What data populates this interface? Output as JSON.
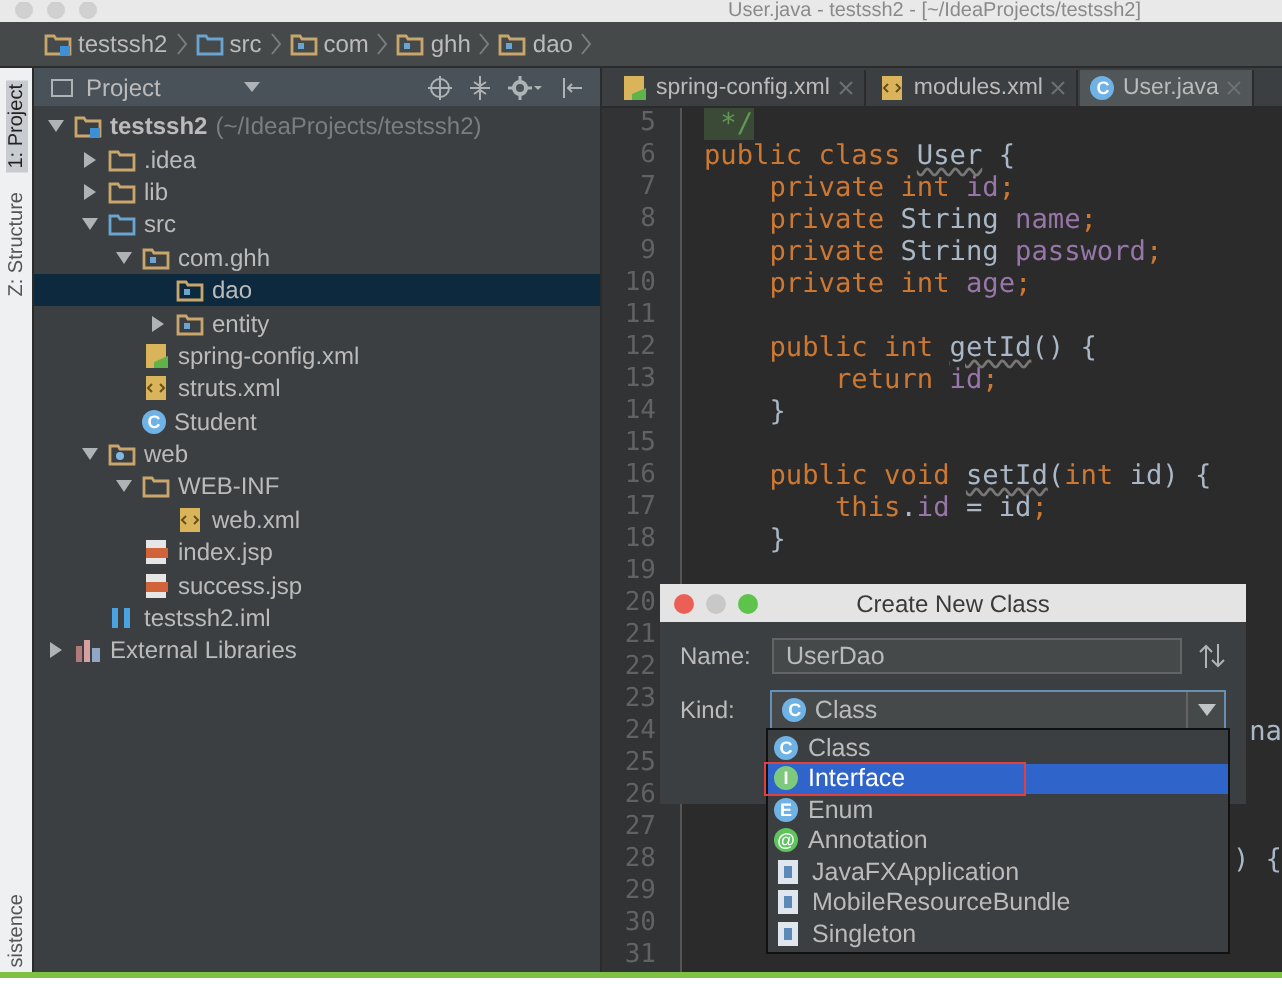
{
  "window": {
    "title": "User.java - testssh2 - [~/IdeaProjects/testssh2]"
  },
  "breadcrumbs": [
    {
      "label": "testssh2",
      "kind": "module"
    },
    {
      "label": "src",
      "kind": "source"
    },
    {
      "label": "com",
      "kind": "package"
    },
    {
      "label": "ghh",
      "kind": "package"
    },
    {
      "label": "dao",
      "kind": "package"
    }
  ],
  "tool_strip": [
    {
      "label": "1: Project",
      "selected": true
    },
    {
      "label": "Z: Structure",
      "selected": false
    },
    {
      "label": "sistence",
      "selected": false
    }
  ],
  "project_panel": {
    "title": "Project",
    "tree": [
      {
        "label": "testssh2",
        "hint": "(~/IdeaProjects/testssh2)",
        "kind": "module",
        "expanded": true,
        "selected": false,
        "children": [
          {
            "label": ".idea",
            "kind": "folder",
            "expanded": false,
            "selected": false
          },
          {
            "label": "lib",
            "kind": "folder",
            "expanded": false,
            "selected": false
          },
          {
            "label": "src",
            "kind": "source",
            "expanded": true,
            "selected": false,
            "children": [
              {
                "label": "com.ghh",
                "kind": "package",
                "expanded": true,
                "selected": false,
                "children": [
                  {
                    "label": "dao",
                    "kind": "package",
                    "selected": true
                  },
                  {
                    "label": "entity",
                    "kind": "package",
                    "expanded": false,
                    "selected": false
                  }
                ]
              },
              {
                "label": "spring-config.xml",
                "kind": "spring",
                "selected": false
              },
              {
                "label": "struts.xml",
                "kind": "xml",
                "selected": false
              },
              {
                "label": "Student",
                "kind": "class",
                "badge": "C",
                "selected": false
              }
            ]
          },
          {
            "label": "web",
            "kind": "web",
            "expanded": true,
            "selected": false,
            "children": [
              {
                "label": "WEB-INF",
                "kind": "folder",
                "expanded": true,
                "selected": false,
                "children": [
                  {
                    "label": "web.xml",
                    "kind": "xml",
                    "selected": false
                  }
                ]
              },
              {
                "label": "index.jsp",
                "kind": "jsp",
                "selected": false
              },
              {
                "label": "success.jsp",
                "kind": "jsp",
                "selected": false
              }
            ]
          },
          {
            "label": "testssh2.iml",
            "kind": "iml",
            "selected": false
          }
        ]
      },
      {
        "label": "External Libraries",
        "kind": "library",
        "expanded": false,
        "selected": false
      }
    ]
  },
  "editor": {
    "tabs": [
      {
        "label": "spring-config.xml",
        "kind": "spring",
        "selected": false
      },
      {
        "label": "modules.xml",
        "kind": "xml",
        "selected": false
      },
      {
        "label": "User.java",
        "kind": "class",
        "badge": "C",
        "selected": true
      }
    ],
    "lines": [
      {
        "number": "5",
        "tokens": [
          {
            "kind": "comment",
            "text": " */"
          }
        ]
      },
      {
        "number": "6",
        "tokens": [
          {
            "kind": "keyword",
            "text": "public class "
          },
          {
            "kind": "warn",
            "text": "User"
          },
          {
            "kind": "plain",
            "text": " {"
          }
        ]
      },
      {
        "number": "7",
        "tokens": [
          {
            "kind": "keyword",
            "text": "    private int "
          },
          {
            "kind": "field",
            "text": "id"
          },
          {
            "kind": "keyword",
            "text": ";"
          }
        ]
      },
      {
        "number": "8",
        "tokens": [
          {
            "kind": "keyword",
            "text": "    private "
          },
          {
            "kind": "plain",
            "text": "String "
          },
          {
            "kind": "field",
            "text": "name"
          },
          {
            "kind": "keyword",
            "text": ";"
          }
        ]
      },
      {
        "number": "9",
        "tokens": [
          {
            "kind": "keyword",
            "text": "    private "
          },
          {
            "kind": "plain",
            "text": "String "
          },
          {
            "kind": "field",
            "text": "password"
          },
          {
            "kind": "keyword",
            "text": ";"
          }
        ]
      },
      {
        "number": "10",
        "tokens": [
          {
            "kind": "keyword",
            "text": "    private int "
          },
          {
            "kind": "field",
            "text": "age"
          },
          {
            "kind": "keyword",
            "text": ";"
          }
        ]
      },
      {
        "number": "11"
      },
      {
        "number": "12",
        "tokens": [
          {
            "kind": "keyword",
            "text": "    public int "
          },
          {
            "kind": "warn",
            "text": "getId"
          },
          {
            "kind": "plain",
            "text": "() {"
          }
        ]
      },
      {
        "number": "13",
        "tokens": [
          {
            "kind": "keyword",
            "text": "        return "
          },
          {
            "kind": "field",
            "text": "id"
          },
          {
            "kind": "keyword",
            "text": ";"
          }
        ]
      },
      {
        "number": "14",
        "tokens": [
          {
            "kind": "plain",
            "text": "    }"
          }
        ]
      },
      {
        "number": "15"
      },
      {
        "number": "16",
        "tokens": [
          {
            "kind": "keyword",
            "text": "    public void "
          },
          {
            "kind": "warn",
            "text": "setId"
          },
          {
            "kind": "plain",
            "text": "("
          },
          {
            "kind": "keyword",
            "text": "int "
          },
          {
            "kind": "plain",
            "text": "id) {"
          }
        ]
      },
      {
        "number": "17",
        "tokens": [
          {
            "kind": "keyword",
            "text": "        this"
          },
          {
            "kind": "plain",
            "text": "."
          },
          {
            "kind": "field",
            "text": "id"
          },
          {
            "kind": "plain",
            "text": " = id"
          },
          {
            "kind": "keyword",
            "text": ";"
          }
        ]
      },
      {
        "number": "18",
        "tokens": [
          {
            "kind": "plain",
            "text": "    }"
          }
        ]
      },
      {
        "number": "19"
      },
      {
        "number": "20"
      },
      {
        "number": "21"
      },
      {
        "number": "22"
      },
      {
        "number": "23"
      },
      {
        "number": "24",
        "tail": "na"
      },
      {
        "number": "25"
      },
      {
        "number": "26"
      },
      {
        "number": "27"
      },
      {
        "number": "28",
        "tail": ") {"
      },
      {
        "number": "29"
      },
      {
        "number": "30"
      },
      {
        "number": "31"
      }
    ]
  },
  "dialog": {
    "title": "Create New Class",
    "name_label": "Name:",
    "name_value": "UserDao",
    "kind_label": "Kind:",
    "kind_value": {
      "label": "Class",
      "badge": "C",
      "kind": "class"
    },
    "options": [
      {
        "label": "Class",
        "kind": "class",
        "badge": "C",
        "selected": false,
        "outlined": false
      },
      {
        "label": "Interface",
        "kind": "interface",
        "badge": "I",
        "selected": true,
        "outlined": true
      },
      {
        "label": "Enum",
        "kind": "enum",
        "badge": "E",
        "selected": false,
        "outlined": false
      },
      {
        "label": "Annotation",
        "kind": "annotation",
        "badge": "@",
        "selected": false,
        "outlined": false
      },
      {
        "label": "JavaFXApplication",
        "kind": "template",
        "selected": false,
        "outlined": false
      },
      {
        "label": "MobileResourceBundle",
        "kind": "template",
        "selected": false,
        "outlined": false
      },
      {
        "label": "Singleton",
        "kind": "template",
        "selected": false,
        "outlined": false
      }
    ]
  }
}
